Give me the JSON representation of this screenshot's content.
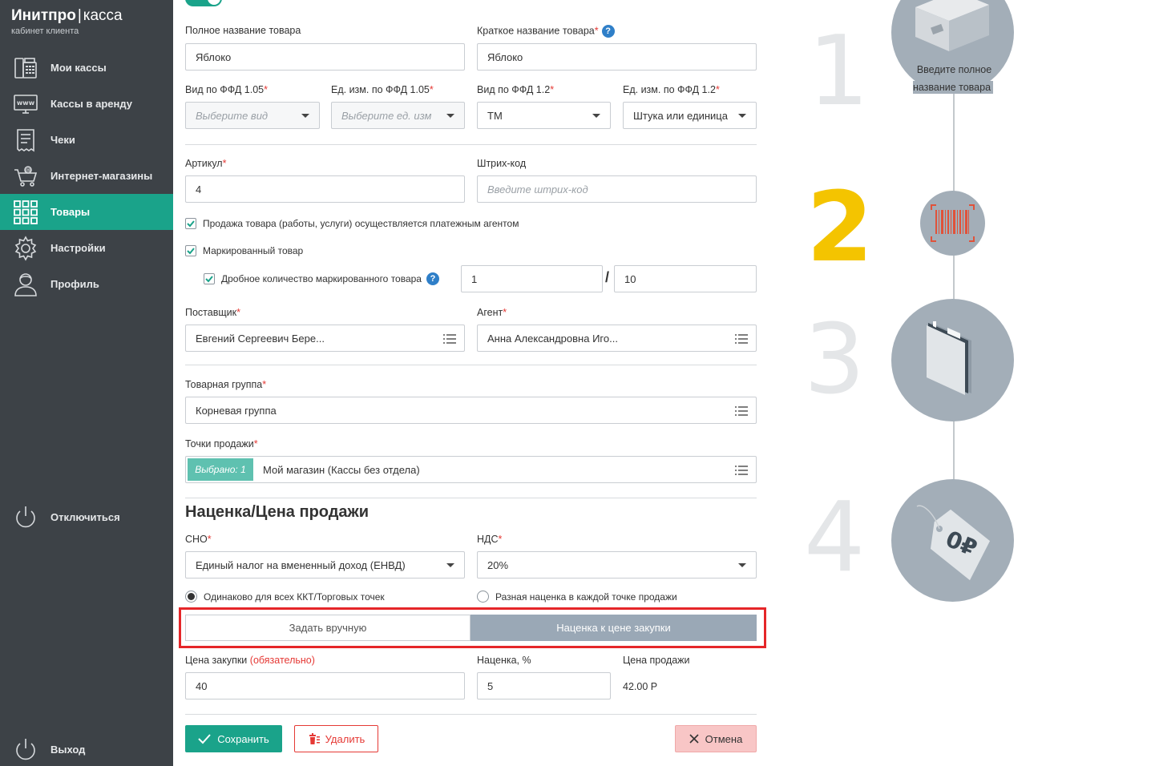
{
  "brand": {
    "name": "Инитпро",
    "separator": "|",
    "sub": "касса",
    "caption": "кабинет клиента"
  },
  "sidebar": {
    "items": [
      {
        "label": "Мои кассы",
        "icon": "cash-register-icon"
      },
      {
        "label": "Кассы в аренду",
        "icon": "www-monitor-icon"
      },
      {
        "label": "Чеки",
        "icon": "receipt-icon"
      },
      {
        "label": "Интернет-магазины",
        "icon": "cart-icon"
      },
      {
        "label": "Товары",
        "icon": "grid-icon",
        "active": true
      },
      {
        "label": "Настройки",
        "icon": "gear-icon"
      },
      {
        "label": "Профиль",
        "icon": "user-icon"
      }
    ],
    "disconnect": "Отключиться",
    "logout": "Выход"
  },
  "form": {
    "full_name": {
      "label": "Полное название товара",
      "value": "Яблоко"
    },
    "short_name": {
      "label": "Краткое название товара",
      "value": "Яблоко",
      "help": "?"
    },
    "ffd105_kind": {
      "label": "Вид по ФФД 1.05",
      "placeholder": "Выберите вид"
    },
    "ffd105_unit": {
      "label": "Ед. изм. по ФФД 1.05",
      "placeholder": "Выберите ед. изм"
    },
    "ffd12_kind": {
      "label": "Вид по ФФД 1.2",
      "value": "ТМ"
    },
    "ffd12_unit": {
      "label": "Ед. изм. по ФФД 1.2",
      "value": "Штука или единица"
    },
    "article": {
      "label": "Артикул",
      "value": "4"
    },
    "barcode": {
      "label": "Штрих-код",
      "placeholder": "Введите штрих-код"
    },
    "agent_sale": {
      "label": "Продажа товара (работы, услуги) осуществляется платежным агентом",
      "checked": true
    },
    "marked": {
      "label": "Маркированный товар",
      "checked": true
    },
    "fractional": {
      "label": "Дробное количество маркированного товара",
      "checked": true,
      "help": "?",
      "numerator": "1",
      "slash": "/",
      "denominator": "10"
    },
    "supplier": {
      "label": "Поставщик",
      "value": "Евгений Сергеевич Бере..."
    },
    "agent": {
      "label": "Агент",
      "value": "Анна Александровна Иго..."
    },
    "group": {
      "label": "Товарная группа",
      "value": "Корневая группа"
    },
    "points": {
      "label": "Точки продажи",
      "badge": "Выбрано: 1",
      "value": "Мой магазин (Кассы без отдела)"
    },
    "section_title": "Наценка/Цена продажи",
    "sno": {
      "label": "СНО",
      "value": "Единый налог на вмененный доход (ЕНВД)"
    },
    "vat": {
      "label": "НДС",
      "value": "20%"
    },
    "radio_same": {
      "label": "Одинаково для всех ККТ/Торговых точек",
      "checked": true
    },
    "radio_diff": {
      "label": "Разная наценка в каждой точке продажи",
      "checked": false
    },
    "seg_manual": "Задать вручную",
    "seg_markup": "Наценка к цене закупки",
    "purchase": {
      "label": "Цена закупки",
      "required_note": "(обязательно)",
      "value": "40"
    },
    "markup": {
      "label": "Наценка, %",
      "value": "5"
    },
    "sale_price": {
      "label": "Цена продажи",
      "value": "42.00 Р"
    },
    "save": "Сохранить",
    "delete": "Удалить",
    "cancel": "Отмена"
  },
  "steps": {
    "items": [
      {
        "number": "1",
        "icon": "box-icon"
      },
      {
        "number": "2",
        "icon": "barcode-icon",
        "active": true
      },
      {
        "number": "3",
        "icon": "folder-icon"
      },
      {
        "number": "4",
        "icon": "price-tag-icon"
      }
    ],
    "tooltip": "Введите полное название товара",
    "tag_text": "0₽"
  },
  "colors": {
    "accent": "#1aa38a",
    "sidebar": "#3d4247",
    "highlight": "#e52629",
    "active_step": "#f4c400"
  }
}
